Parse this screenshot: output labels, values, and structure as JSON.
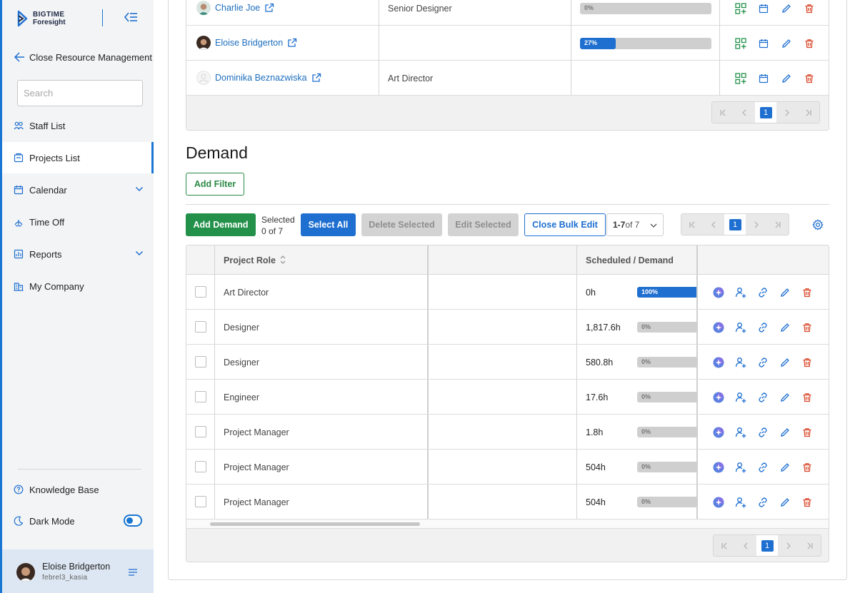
{
  "brand": {
    "line1": "BIGTIME",
    "line2": "Foresight"
  },
  "sidebar": {
    "back_label": "Close Resource Management",
    "search_placeholder": "Search",
    "items": [
      {
        "label": "Staff List",
        "icon": "users-icon"
      },
      {
        "label": "Projects List",
        "icon": "projects-icon",
        "active": true
      },
      {
        "label": "Calendar",
        "icon": "calendar-icon",
        "expandable": true
      },
      {
        "label": "Time Off",
        "icon": "time-off-icon"
      },
      {
        "label": "Reports",
        "icon": "reports-icon",
        "expandable": true
      },
      {
        "label": "My Company",
        "icon": "company-icon"
      }
    ],
    "knowledge_base": "Knowledge Base",
    "dark_mode": "Dark Mode",
    "dark_mode_on": true,
    "user": {
      "name": "Eloise Bridgerton",
      "handle": "febrel3_kasia"
    }
  },
  "staff": {
    "rows": [
      {
        "name": "Charlie Joe",
        "role": "Senior Designer",
        "progress_label": "0%",
        "progress": 0
      },
      {
        "name": "Eloise Bridgerton",
        "role": "",
        "progress_label": "27%",
        "progress": 27
      },
      {
        "name": "Dominika Beznazwiska",
        "role": "Art Director",
        "progress_label": "",
        "progress": null
      }
    ],
    "page": "1"
  },
  "demand": {
    "title": "Demand",
    "add_filter": "Add Filter",
    "add_demand": "Add Demand",
    "selected_label": "Selected",
    "selected_count": "0 of 7",
    "select_all": "Select All",
    "delete_selected": "Delete Selected",
    "edit_selected": "Edit Selected",
    "close_bulk_edit": "Close Bulk Edit",
    "range_bold": "1-7",
    "range_rest": " of 7",
    "page": "1",
    "columns": {
      "role": "Project Role",
      "scheduled": "Scheduled / Demand"
    },
    "rows": [
      {
        "role": "Art Director",
        "hours": "0h",
        "pct_label": "100%",
        "pct": 100
      },
      {
        "role": "Designer",
        "hours": "1,817.6h",
        "pct_label": "0%",
        "pct": 0
      },
      {
        "role": "Designer",
        "hours": "580.8h",
        "pct_label": "0%",
        "pct": 0
      },
      {
        "role": "Engineer",
        "hours": "17.6h",
        "pct_label": "0%",
        "pct": 0
      },
      {
        "role": "Project Manager",
        "hours": "1.8h",
        "pct_label": "0%",
        "pct": 0
      },
      {
        "role": "Project Manager",
        "hours": "504h",
        "pct_label": "0%",
        "pct": 0
      },
      {
        "role": "Project Manager",
        "hours": "504h",
        "pct_label": "0%",
        "pct": 0
      }
    ]
  },
  "colors": {
    "accent": "#1e6fd0",
    "green": "#23914a",
    "red": "#d9482b"
  }
}
